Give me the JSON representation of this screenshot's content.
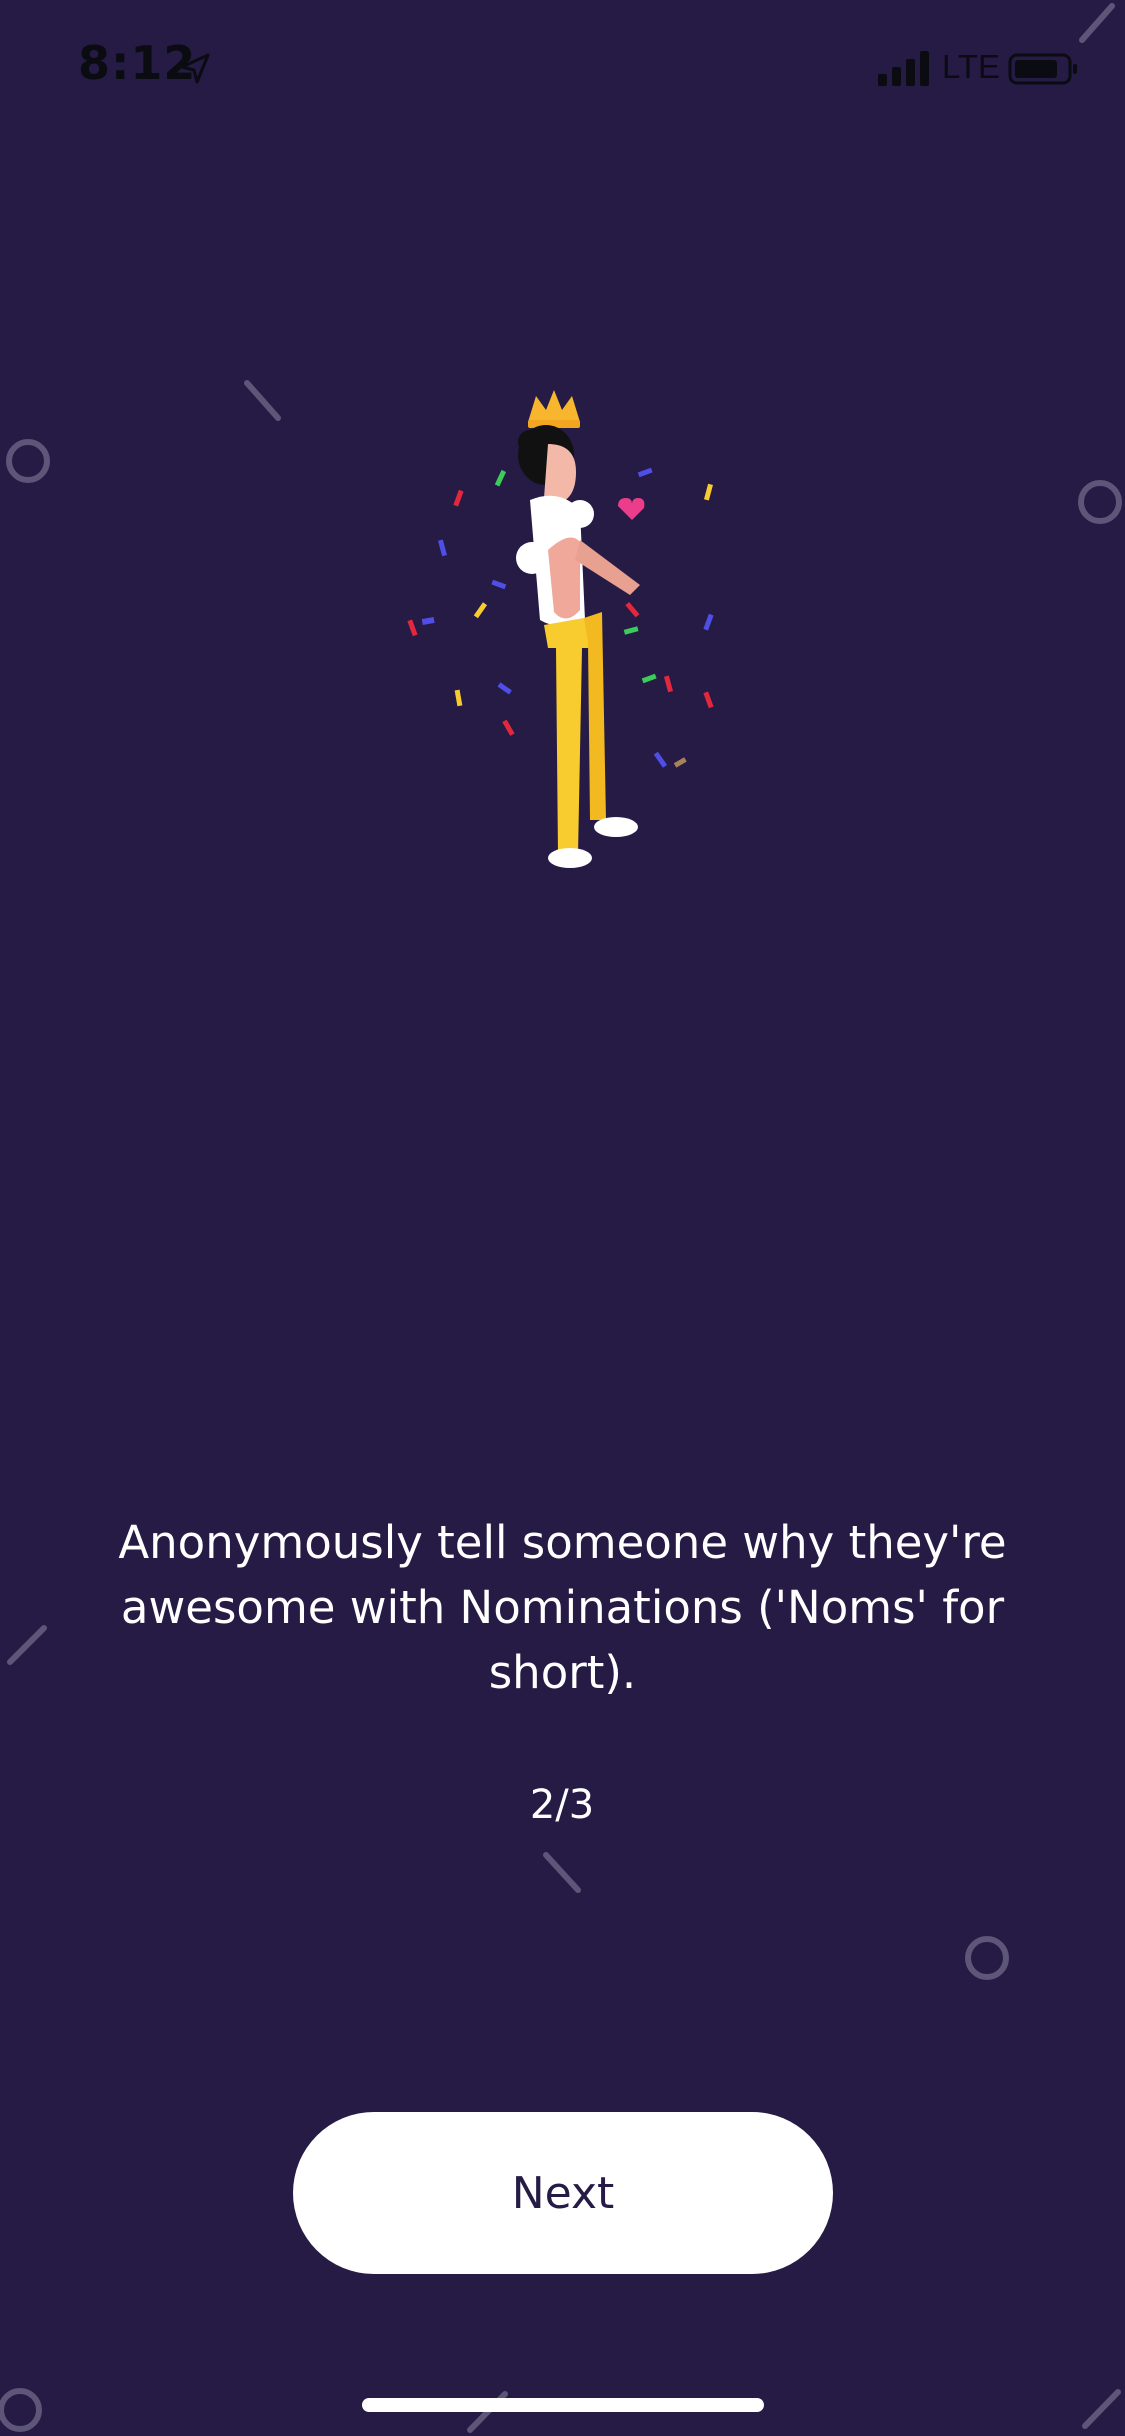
{
  "status_bar": {
    "time": "8:12",
    "network": "LTE",
    "icons": [
      "location-arrow-icon",
      "cellular-signal-icon",
      "battery-icon"
    ]
  },
  "onboarding": {
    "illustration": "person-with-crown-celebrating-illustration",
    "message": "Anonymously tell someone why they're awesome with Nominations ('Noms' for short).",
    "pager": "2/3"
  },
  "actions": {
    "next_label": "Next"
  },
  "colors": {
    "background": "#251b45",
    "accent_yellow": "#f8cc2e",
    "button_bg": "#ffffff",
    "button_text": "#251b45",
    "decor": "#5e5678"
  }
}
